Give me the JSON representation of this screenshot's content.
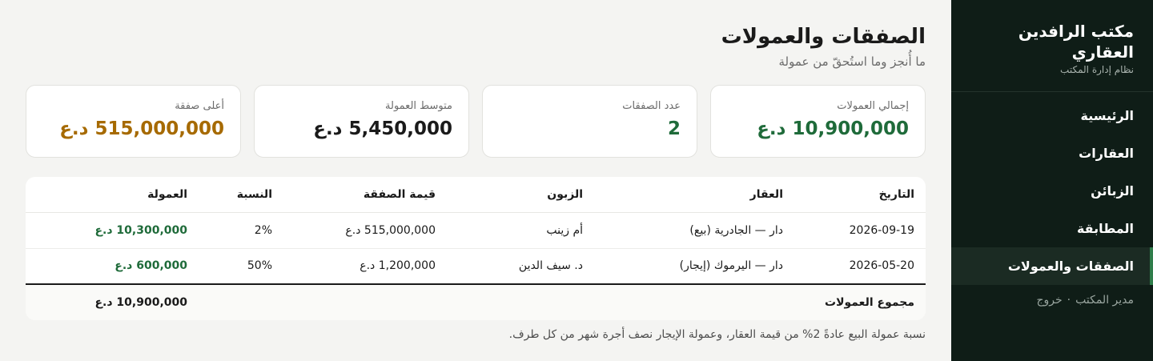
{
  "sidebar": {
    "brand_title": "مكتب الرافدين العقاري",
    "brand_subtitle": "نظام إدارة المكتب",
    "items": [
      {
        "label": "الرئيسية"
      },
      {
        "label": "العقارات"
      },
      {
        "label": "الزبائن"
      },
      {
        "label": "المطابقة"
      },
      {
        "label": "الصفقات والعمولات"
      }
    ],
    "user_name": "مدير المكتب",
    "separator": "·",
    "logout_label": "خروج"
  },
  "header": {
    "title": "الصفقات والعمولات",
    "subtitle": "ما أُنجز وما استُحقّ من عمولة"
  },
  "cards": [
    {
      "label": "إجمالي العمولات",
      "value": "10,900,000 د.ع"
    },
    {
      "label": "عدد الصفقات",
      "value": "2"
    },
    {
      "label": "متوسط العمولة",
      "value": "5,450,000 د.ع"
    },
    {
      "label": "أعلى صفقة",
      "value": "515,000,000 د.ع"
    }
  ],
  "table": {
    "headers": [
      "التاريخ",
      "العقار",
      "الزبون",
      "قيمة الصفقة",
      "النسبة",
      "العمولة"
    ],
    "rows": [
      [
        "2026-09-19",
        "دار — الجادرية (بيع)",
        "أم زينب",
        "515,000,000 د.ع",
        "2%",
        "10,300,000 د.ع"
      ],
      [
        "2026-05-20",
        "دار — اليرموك (إيجار)",
        "د. سيف الدين",
        "1,200,000 د.ع",
        "50%",
        "600,000 د.ع"
      ]
    ],
    "footer_label": "مجموع العمولات",
    "footer_total": "10,900,000 د.ع"
  },
  "note": "نسبة عمولة البيع عادةً 2% من قيمة العقار، وعمولة الإيجار نصف أجرة شهر من كل طرف.",
  "colors": {
    "sidebar_bg": "#0f1d17",
    "accent_green": "#1f6b3a",
    "accent_gold": "#a66a00"
  }
}
